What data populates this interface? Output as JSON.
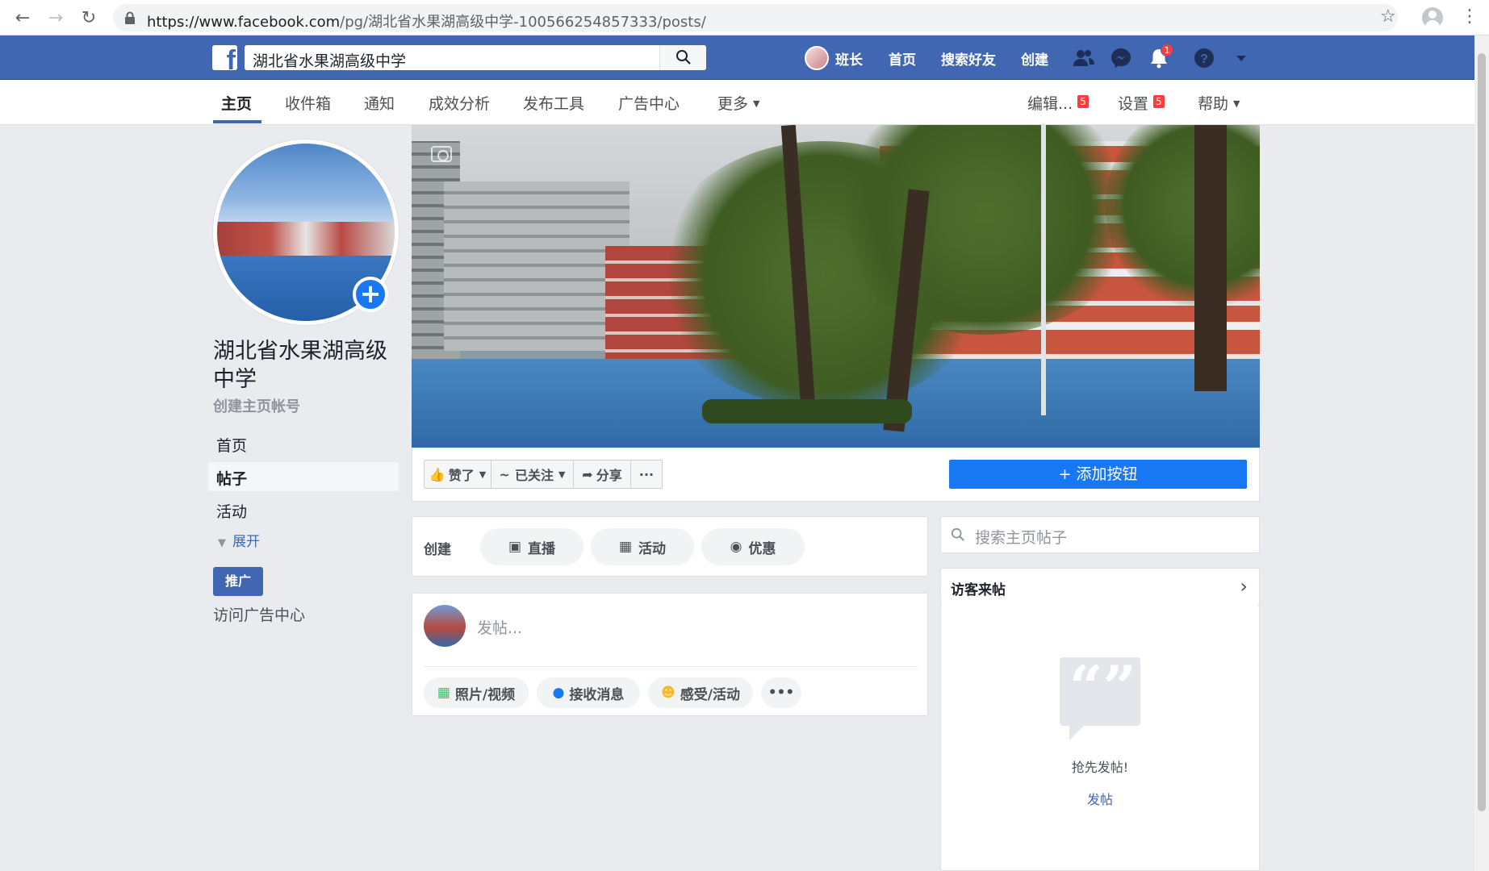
{
  "browser": {
    "url_host": "https://www.facebook.com",
    "url_path": "/pg/湖北省水果湖高级中学-100566254857333/posts/"
  },
  "topbar": {
    "search_value": "湖北省水果湖高级中学",
    "user_name": "班长",
    "home": "首页",
    "find_friends": "搜索好友",
    "create": "创建",
    "notification_count": "1"
  },
  "page_tabs": {
    "items": [
      "主页",
      "收件箱",
      "通知",
      "成效分析",
      "发布工具",
      "广告中心",
      "更多"
    ],
    "edit": "编辑...",
    "edit_badge": "5",
    "settings": "设置",
    "settings_badge": "5",
    "help": "帮助"
  },
  "sidebar": {
    "page_name": "湖北省水果湖高级中学",
    "sub": "创建主页帐号",
    "nav": [
      "首页",
      "帖子",
      "活动"
    ],
    "expand": "展开",
    "promote": "推广",
    "ads_center": "访问广告中心"
  },
  "actions": {
    "like": "赞了",
    "follow": "已关注",
    "share": "分享",
    "more": "···",
    "add_button": "添加按钮"
  },
  "create": {
    "label": "创建",
    "live": "直播",
    "event": "活动",
    "offer": "优惠"
  },
  "composer": {
    "placeholder": "发帖...",
    "photo": "照片/视频",
    "messages": "接收消息",
    "feeling": "感受/活动",
    "more": "•••"
  },
  "right": {
    "search_placeholder": "搜索主页帖子",
    "visitor_posts": "访客来帖",
    "empty_text": "抢先发帖!",
    "post_link": "发帖"
  },
  "colors": {
    "fb_blue": "#4267b2",
    "primary": "#1877f2",
    "badge": "#fa3e3e"
  }
}
